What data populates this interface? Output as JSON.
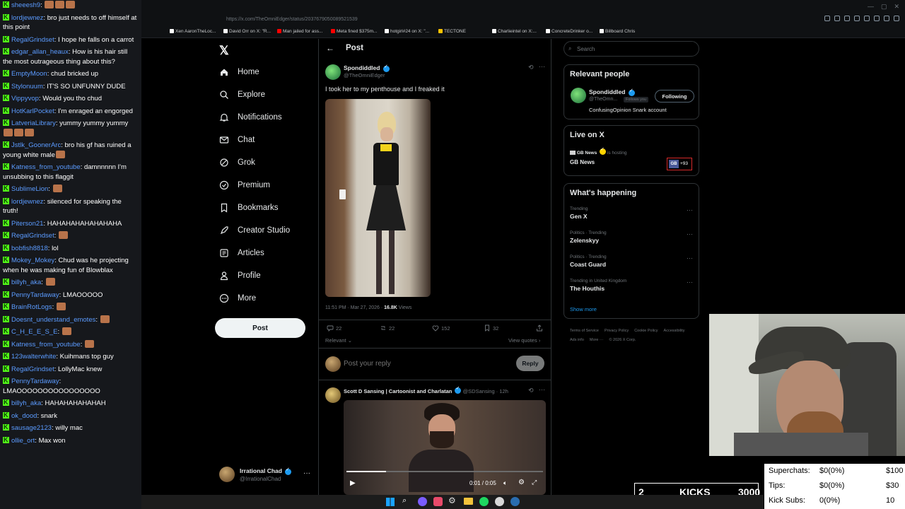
{
  "chat": {
    "messages": [
      {
        "user": "sheeesh9",
        "text": "",
        "emotes": 3
      },
      {
        "user": "lordjewnez",
        "text": "bro just needs to off himself at this point",
        "emotes": 0
      },
      {
        "user": "RegalGrindset",
        "text": "I hope he falls on a carrot",
        "emotes": 0
      },
      {
        "user": "edgar_allan_heaux",
        "text": "How is his hair still the most outrageous thing about this?",
        "emotes": 0
      },
      {
        "user": "EmptyMoon",
        "text": "chud bricked up",
        "emotes": 0
      },
      {
        "user": "Stylonuum",
        "text": "IT'S SO UNFUNNY DUDE",
        "emotes": 0
      },
      {
        "user": "Vippyvop",
        "text": "Would you tho chud",
        "emotes": 0
      },
      {
        "user": "HotKarlPocket",
        "text": "I'm enraged an engorged",
        "emotes": 0
      },
      {
        "user": "LatveriaLibrary",
        "text": "yummy yummy yummy",
        "emotes": 3
      },
      {
        "user": "Jstlk_GoonerArc",
        "text": "bro his gf has ruined a young white male",
        "emotes": 1
      },
      {
        "user": "Katness_from_youtube",
        "text": "damnnnnn I'm unsubbing to this flaggit",
        "emotes": 0
      },
      {
        "user": "SublimeLion",
        "text": "",
        "emotes": 1
      },
      {
        "user": "lordjewnez",
        "text": "silenced for speaking the truth!",
        "emotes": 0
      },
      {
        "user": "Piterson21",
        "text": "HAHAHAHAHAHAHAHA",
        "emotes": 0
      },
      {
        "user": "RegalGrindset",
        "text": "",
        "emotes": 1
      },
      {
        "user": "bobfish8818",
        "text": "lol",
        "emotes": 0
      },
      {
        "user": "Mokey_Mokey",
        "text": "Chud was he projecting when he was making fun of Blowblax",
        "emotes": 0
      },
      {
        "user": "billyh_aka",
        "text": "",
        "emotes": 1
      },
      {
        "user": "PennyTardaway",
        "text": "LMAOOOOO",
        "emotes": 0
      },
      {
        "user": "BrainRotLogs",
        "text": "",
        "emotes": 1
      },
      {
        "user": "Doesnt_understand_emotes",
        "text": "",
        "emotes": 1
      },
      {
        "user": "C_H_E_E_S_E",
        "text": "",
        "emotes": 1
      },
      {
        "user": "Katness_from_youtube",
        "text": "",
        "emotes": 1
      },
      {
        "user": "123walterwhite",
        "text": "Kuihmans top guy",
        "emotes": 0
      },
      {
        "user": "RegalGrindset",
        "text": "LollyMac knew",
        "emotes": 0
      },
      {
        "user": "PennyTardaway",
        "text": "LMAOOOOOOOOOOOOOOOO",
        "emotes": 0
      },
      {
        "user": "billyh_aka",
        "text": "HAHAHAHAHAHAH",
        "emotes": 0
      },
      {
        "user": "ok_dood",
        "text": "snark",
        "emotes": 0
      },
      {
        "user": "sausage2123",
        "text": "willy mac",
        "emotes": 0
      },
      {
        "user": "ollie_ort",
        "text": "Max won",
        "emotes": 0
      }
    ]
  },
  "browser": {
    "url": "https://x.com/TheOmniEdger/status/2037679050089521539",
    "bookmarks": [
      {
        "label": "Xen AaronTheLoc...",
        "color": "#ffffff"
      },
      {
        "label": "David Orr on X: \"R...",
        "color": "#ffffff"
      },
      {
        "label": "Man jailed for ass...",
        "color": "#ff0000"
      },
      {
        "label": "Meta fined $375m...",
        "color": "#ff0000"
      },
      {
        "label": "hotgirl#24 on X: \"...",
        "color": "#ffffff"
      },
      {
        "label": "TECTONE",
        "color": "#ffc400"
      },
      {
        "label": "Charlieintel on X:...",
        "color": "#ffffff"
      },
      {
        "label": "ConcreteDrinker o...",
        "color": "#ffffff"
      },
      {
        "label": "Billboard Chris",
        "color": "#ffffff"
      }
    ]
  },
  "nav": {
    "logo": "𝕏",
    "items": [
      {
        "label": "Home",
        "icon": "home-icon"
      },
      {
        "label": "Explore",
        "icon": "search-icon"
      },
      {
        "label": "Notifications",
        "icon": "bell-icon"
      },
      {
        "label": "Chat",
        "icon": "mail-icon"
      },
      {
        "label": "Grok",
        "icon": "grok-icon"
      },
      {
        "label": "Premium",
        "icon": "verified-icon"
      },
      {
        "label": "Bookmarks",
        "icon": "bookmark-icon"
      },
      {
        "label": "Creator Studio",
        "icon": "rocket-icon"
      },
      {
        "label": "Articles",
        "icon": "article-icon"
      },
      {
        "label": "Profile",
        "icon": "person-icon"
      },
      {
        "label": "More",
        "icon": "more-circle-icon"
      }
    ],
    "post_button": "Post",
    "account": {
      "name": "Irrational Chad",
      "handle": "@IrrationalChad"
    }
  },
  "main": {
    "header_title": "Post",
    "post": {
      "author": "Spondiddled",
      "handle": "@TheOmniEdger",
      "text": "I took her to my penthouse and I freaked it",
      "timestamp": "11:51 PM · Mar 27, 2026 ·",
      "views_count": "16.8K",
      "views_label": "Views",
      "replies": "22",
      "reposts": "22",
      "likes": "152",
      "bookmarks": "32",
      "relevant_label": "Relevant",
      "view_quotes": "View quotes"
    },
    "reply_placeholder": "Post your reply",
    "reply_button": "Reply",
    "reply": {
      "author": "Scott D Sansing | Cartoonist and Charlatan",
      "handle": "@SDSansing",
      "age": "· 12h",
      "video_time": "0:01 / 0:05",
      "progress": 0.2
    }
  },
  "sidebar": {
    "search_placeholder": "Search",
    "relevant_people": {
      "title": "Relevant people",
      "name": "Spondiddled",
      "handle": "@TheOmn...",
      "follows_you": "Follows you",
      "bio": "ConfusingOpinion Snark account",
      "follow_button": "Following"
    },
    "live": {
      "title": "Live on X",
      "host": "GB News",
      "host_status": "is hosting",
      "name": "GB News",
      "badge_logo": "GB",
      "badge_count": "+93"
    },
    "happening": {
      "title": "What's happening",
      "trends": [
        {
          "meta": "Trending",
          "name": "Gen X"
        },
        {
          "meta": "Politics · Trending",
          "name": "Zelenskyy"
        },
        {
          "meta": "Politics · Trending",
          "name": "Coast Guard"
        },
        {
          "meta": "Trending in United Kingdom",
          "name": "The Houthis"
        }
      ],
      "show_more": "Show more"
    },
    "footer": [
      "Terms of Service",
      "Privacy Policy",
      "Cookie Policy",
      "Accessibility",
      "Ads info",
      "More ···",
      "© 2026 X Corp."
    ]
  },
  "overlay": {
    "kicks_count": "2",
    "kicks_label": "KICKS",
    "kicks_goal": "3000",
    "stats": [
      {
        "label": "Superchats:",
        "value": "$0(0%)",
        "goal": "$100"
      },
      {
        "label": "Tips:",
        "value": "$0(0%)",
        "goal": "$30"
      },
      {
        "label": "Kick Subs:",
        "value": "0(0%)",
        "goal": "10"
      }
    ]
  }
}
